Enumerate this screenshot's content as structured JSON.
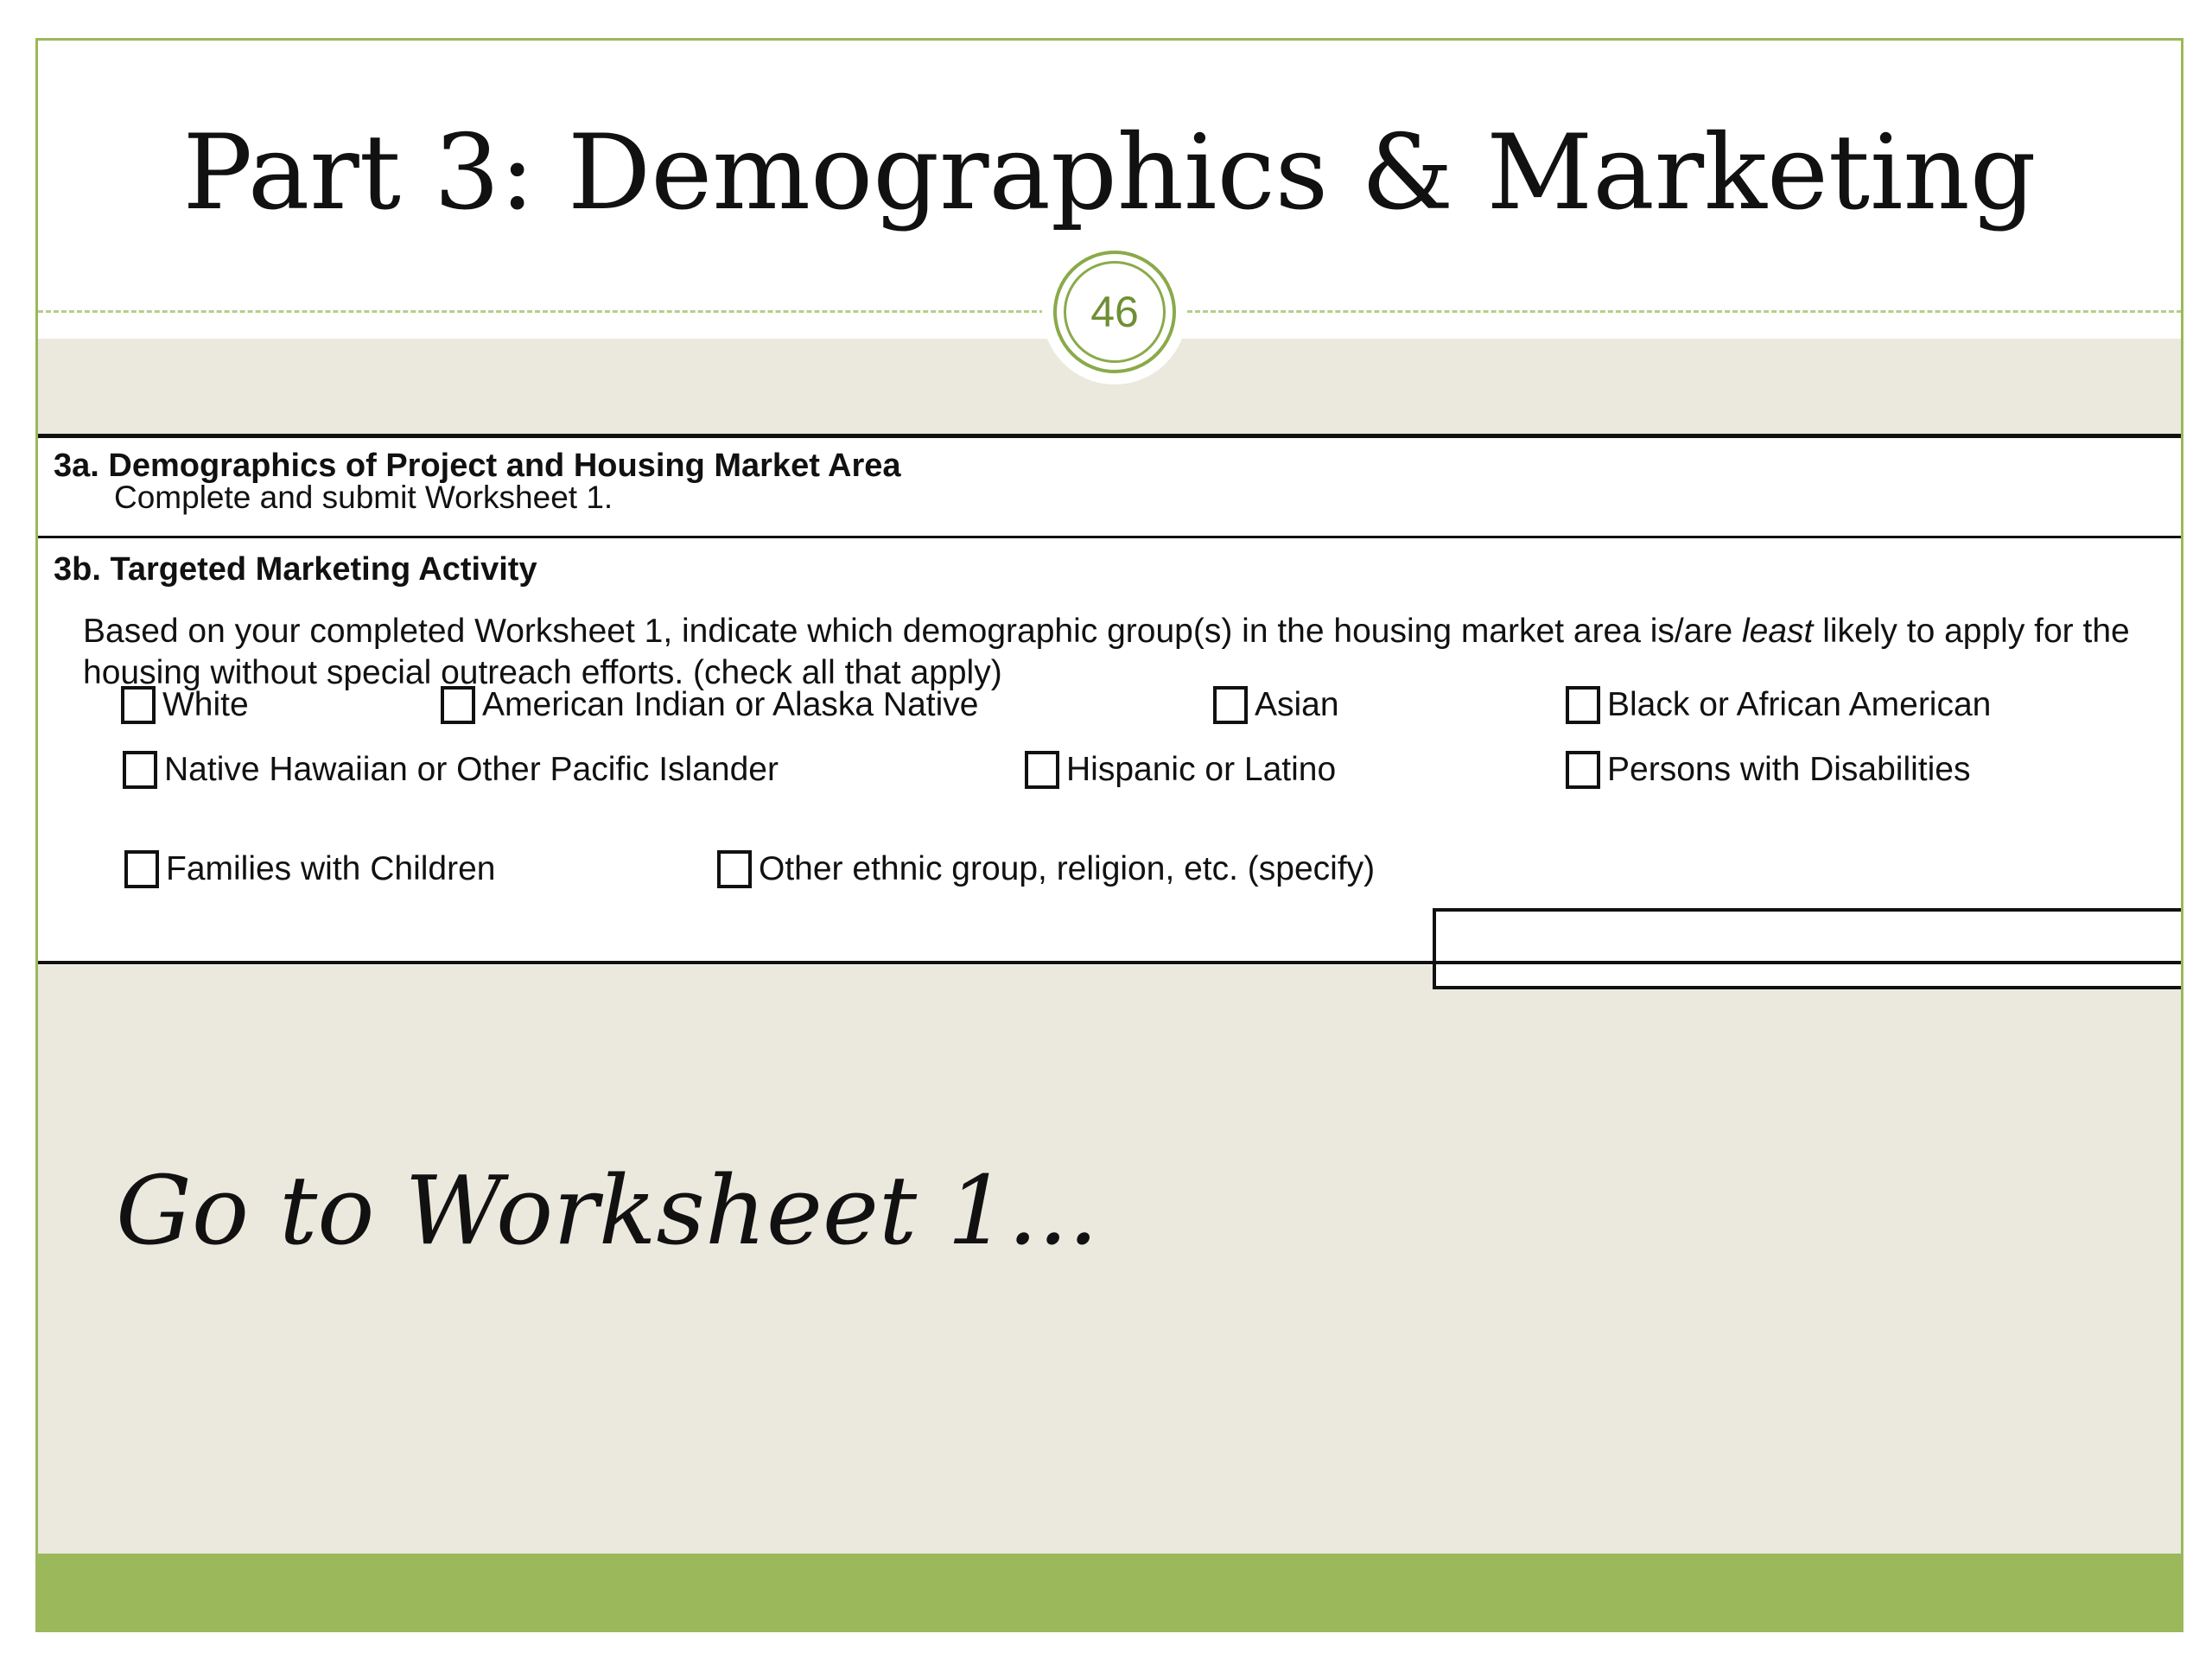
{
  "slide": {
    "title": "Part 3: Demographics & Marketing",
    "page_number": "46",
    "callout": "Go to Worksheet 1..."
  },
  "form": {
    "section_a": {
      "title": "3a. Demographics of Project and Housing Market Area",
      "instruction": "Complete and submit Worksheet 1."
    },
    "section_b": {
      "title": "3b. Targeted Marketing Activity",
      "instruction_part1": "Based on your completed Worksheet 1, indicate which demographic group(s) in the housing market area is/are ",
      "instruction_emphasis": "least",
      "instruction_part2": " likely to apply for the",
      "instruction_line2": "housing without special outreach efforts. (check all that apply)",
      "options": [
        {
          "label": "White",
          "checked": false
        },
        {
          "label": "American Indian or Alaska Native",
          "checked": false
        },
        {
          "label": "Asian",
          "checked": false
        },
        {
          "label": "Black or African American",
          "checked": false
        },
        {
          "label": "Native Hawaiian or Other Pacific Islander",
          "checked": false
        },
        {
          "label": "Hispanic or Latino",
          "checked": false
        },
        {
          "label": "Persons with Disabilities",
          "checked": false
        },
        {
          "label": "Families with Children",
          "checked": false
        },
        {
          "label": "Other ethnic group, religion, etc. (specify)",
          "checked": false
        }
      ],
      "specify_value": ""
    }
  },
  "colors": {
    "accent_green": "#9bb85a",
    "badge_green": "#8aaa4a",
    "background_beige": "#ebe8dd"
  }
}
